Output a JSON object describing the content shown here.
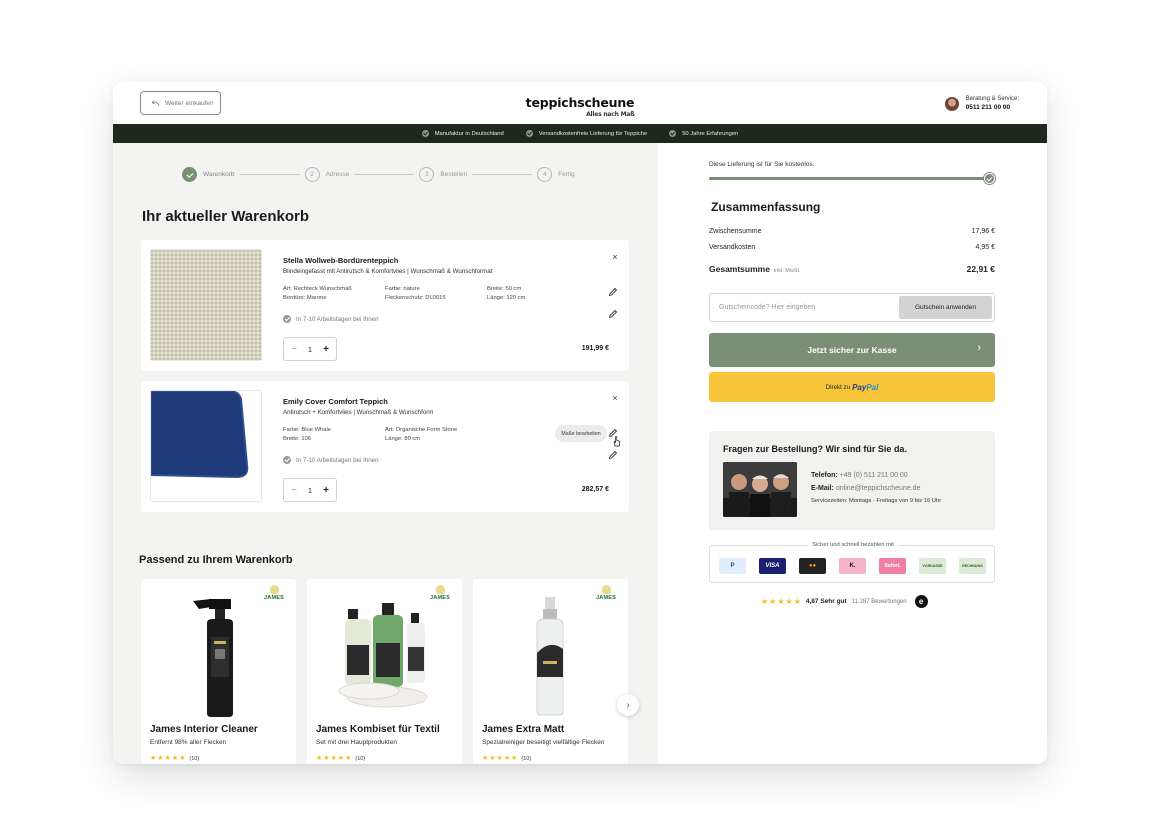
{
  "header": {
    "back_label": "Weiter einkaufen",
    "logo_main": "teppichscheune",
    "logo_sub": "Alles nach Maß",
    "service_label": "Beratung & Service:",
    "service_phone": "0511 211 00 00"
  },
  "usp_bar": [
    "Manufaktur in Deutschland",
    "Versandkostenfreie Lieferung für Teppiche",
    "50 Jahre Erfahrungen"
  ],
  "steps": [
    {
      "num": "",
      "label": "Warenkorb",
      "done": true
    },
    {
      "num": "2",
      "label": "Adresse"
    },
    {
      "num": "3",
      "label": "Bestellen"
    },
    {
      "num": "4",
      "label": "Fertig"
    }
  ],
  "cart": {
    "title": "Ihr aktueller Warenkorb",
    "items": [
      {
        "name": "Stella Wollweb-Bordürenteppich",
        "subtitle": "Blindeingefasst mit Antirutsch & Komfortvlies | Wunschmaß & Wunschformat",
        "attrs": [
          "Art: Rechteck Wunschmaß",
          "Farbe: nature",
          "Breite: 50 cm",
          "Bordüre: Marone",
          "Fleckenschutz: DL0015",
          "Länge: 120 cm"
        ],
        "delivery": "In 7-10 Arbeitstagen bei Ihnen",
        "qty": "1",
        "price": "191,99 €"
      },
      {
        "name": "Emily Cover Comfort Teppich",
        "subtitle": "Antirutsch + Komfortvlies | Wunschmaß & Wunschform",
        "attrs": [
          "Farbe: Blue Whale",
          "Art: Organische Form Stone",
          "Breite: 106",
          "Länge: 80 cm"
        ],
        "delivery": "In 7-10 Arbeitstagen bei Ihnen",
        "qty": "1",
        "price": "282,57 €",
        "edit_tooltip": "Maße bearbeiten"
      }
    ]
  },
  "recommendations": {
    "title": "Passend zu Ihrem Warenkorb",
    "items": [
      {
        "name": "James Interior Cleaner",
        "desc": "Entfernt 98% aller Flecken",
        "reviews": "(10)",
        "badge": "JAMES"
      },
      {
        "name": "James Kombiset für Textil",
        "desc": "Set mit drei Hauptprodukten",
        "reviews": "(10)",
        "badge": "JAMES"
      },
      {
        "name": "James Extra Matt",
        "desc": "Spezialreiniger beseitigt vielfältige Flecken",
        "reviews": "(10)",
        "badge": "JAMES"
      }
    ]
  },
  "summary": {
    "free_shipping_note": "Diese Lieferung ist für Sie kostenlos.",
    "title": "Zusammenfassung",
    "subtotal_label": "Zwischensumme",
    "subtotal": "17,96 €",
    "shipping_label": "Versandkosten",
    "shipping": "4,95 €",
    "total_label": "Gesamtsumme",
    "total_tax": "inkl. MwSt.",
    "total": "22,91 €",
    "coupon_placeholder": "Gutscheincode? Hier eingeben",
    "coupon_button": "Gutschein anwenden",
    "checkout_button": "Jetzt sicher zur Kasse",
    "paypal_prefix": "Direkt zu",
    "paypal_a": "Pay",
    "paypal_b": "Pal"
  },
  "contact": {
    "title": "Fragen zur Bestellung? Wir sind für Sie da.",
    "phone_label": "Telefon:",
    "phone": "+49 (0) 511 211 00 00",
    "email_label": "E-Mail:",
    "email": "online@teppichscheune.de",
    "hours": "Servicezeiten: Montags - Freitags von 9 bis 16 Uhr"
  },
  "payments": {
    "title": "Sicher und schnell bezahlen mit",
    "methods": [
      {
        "label": "P",
        "bg": "#dfeefa",
        "fg": "#1b3e8a"
      },
      {
        "label": "VISA",
        "bg": "#1a1f71",
        "fg": "#ffffff"
      },
      {
        "label": "●●",
        "bg": "#232323",
        "fg": "#f79e1b"
      },
      {
        "label": "K.",
        "bg": "#f5b4c8",
        "fg": "#111111"
      },
      {
        "label": "Sofort.",
        "bg": "#ef7fa5",
        "fg": "#ffffff"
      },
      {
        "label": "VORKASSE",
        "bg": "#dcead8",
        "fg": "#2f5b2a"
      },
      {
        "label": "RECHNUNG",
        "bg": "#dcead8",
        "fg": "#2f5b2a"
      }
    ]
  },
  "rating": {
    "score": "4,87",
    "label": "Sehr gut",
    "count": "11.287 Bewertungen",
    "stars": 5,
    "stars_text": "★★★★★",
    "badge": "e"
  },
  "colors": {
    "accent": "#7b8f76",
    "bar": "#1d2a1b",
    "paypal": "#f8c53a"
  }
}
